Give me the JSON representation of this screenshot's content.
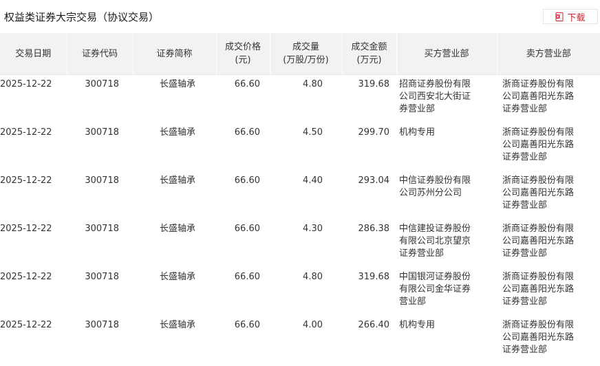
{
  "page": {
    "title": "权益类证券大宗交易（协议交易）",
    "download_label": "下载",
    "accent_color": "#c8282e"
  },
  "table": {
    "headers": [
      {
        "line1": "交易日期",
        "line2": ""
      },
      {
        "line1": "证券代码",
        "line2": ""
      },
      {
        "line1": "证券简称",
        "line2": ""
      },
      {
        "line1": "成交价格",
        "line2": "(元)"
      },
      {
        "line1": "成交量",
        "line2": "(万股/万份)"
      },
      {
        "line1": "成交金额",
        "line2": "(万元)"
      },
      {
        "line1": "买方营业部",
        "line2": ""
      },
      {
        "line1": "卖方营业部",
        "line2": ""
      }
    ],
    "rows": [
      {
        "date": "2025-12-22",
        "code": "300718",
        "name": "长盛轴承",
        "price": "66.60",
        "volume": "4.80",
        "amount": "319.68",
        "buyer": "招商证券股份有限公司西安北大街证券营业部",
        "seller": "浙商证券股份有限公司嘉善阳光东路证券营业部"
      },
      {
        "date": "2025-12-22",
        "code": "300718",
        "name": "长盛轴承",
        "price": "66.60",
        "volume": "4.50",
        "amount": "299.70",
        "buyer": "机构专用",
        "seller": "浙商证券股份有限公司嘉善阳光东路证券营业部"
      },
      {
        "date": "2025-12-22",
        "code": "300718",
        "name": "长盛轴承",
        "price": "66.60",
        "volume": "4.40",
        "amount": "293.04",
        "buyer": "中信证券股份有限公司苏州分公司",
        "seller": "浙商证券股份有限公司嘉善阳光东路证券营业部"
      },
      {
        "date": "2025-12-22",
        "code": "300718",
        "name": "长盛轴承",
        "price": "66.60",
        "volume": "4.30",
        "amount": "286.38",
        "buyer": "中信建投证券股份有限公司北京望京证券营业部",
        "seller": "浙商证券股份有限公司嘉善阳光东路证券营业部"
      },
      {
        "date": "2025-12-22",
        "code": "300718",
        "name": "长盛轴承",
        "price": "66.60",
        "volume": "4.80",
        "amount": "319.68",
        "buyer": "中国银河证券股份有限公司金华证券营业部",
        "seller": "浙商证券股份有限公司嘉善阳光东路证券营业部"
      },
      {
        "date": "2025-12-22",
        "code": "300718",
        "name": "长盛轴承",
        "price": "66.60",
        "volume": "4.00",
        "amount": "266.40",
        "buyer": "机构专用",
        "seller": "浙商证券股份有限公司嘉善阳光东路证券营业部"
      }
    ]
  }
}
